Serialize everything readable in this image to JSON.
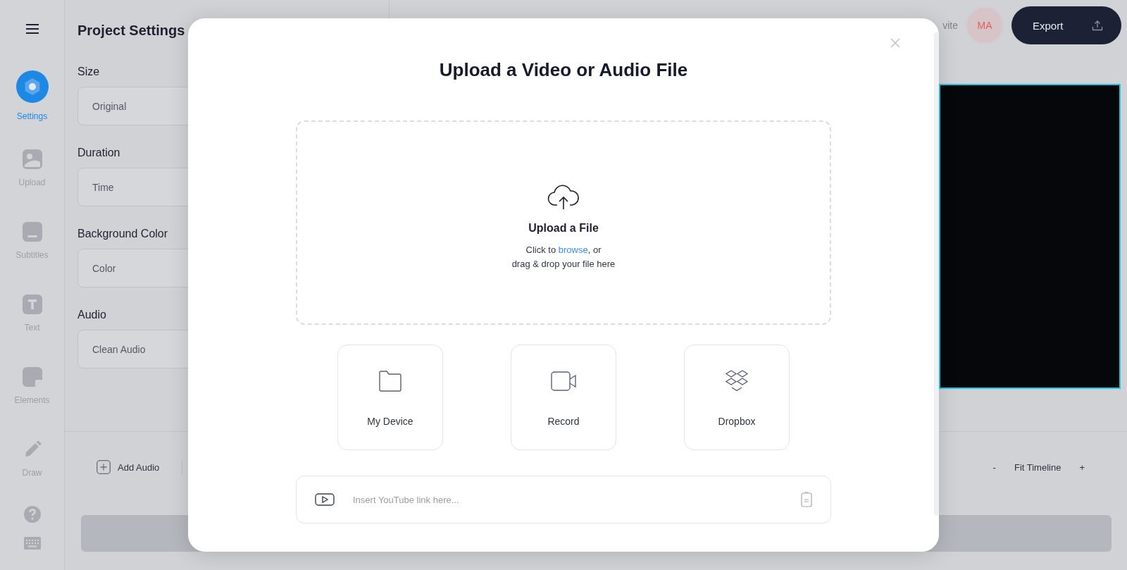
{
  "sidebar": {
    "items": [
      {
        "label": "Settings",
        "selected": true
      },
      {
        "label": "Upload",
        "selected": false
      },
      {
        "label": "Subtitles",
        "selected": false
      },
      {
        "label": "Text",
        "selected": false
      },
      {
        "label": "Elements",
        "selected": false
      },
      {
        "label": "Draw",
        "selected": false
      }
    ]
  },
  "settings_panel": {
    "title": "Project Settings",
    "fields": [
      {
        "label": "Size",
        "value": "Original"
      },
      {
        "label": "Duration",
        "value": "Time"
      },
      {
        "label": "Background Color",
        "value": "Color"
      },
      {
        "label": "Audio",
        "value": "Clean Audio"
      }
    ]
  },
  "header": {
    "invite": "vite",
    "avatar": "MA",
    "export": "Export"
  },
  "timeline": {
    "add_audio": "Add Audio",
    "zoom_out": "-",
    "fit": "Fit Timeline",
    "zoom_in": "+"
  },
  "modal": {
    "title": "Upload a Video or Audio File",
    "dropzone": {
      "heading": "Upload a File",
      "before": "Click to ",
      "link": "browse",
      "after": ", or",
      "line2": "drag & drop your file here"
    },
    "sources": [
      {
        "label": "My Device"
      },
      {
        "label": "Record"
      },
      {
        "label": "Dropbox"
      }
    ],
    "link_field": {
      "placeholder": "Insert YouTube link here..."
    }
  }
}
